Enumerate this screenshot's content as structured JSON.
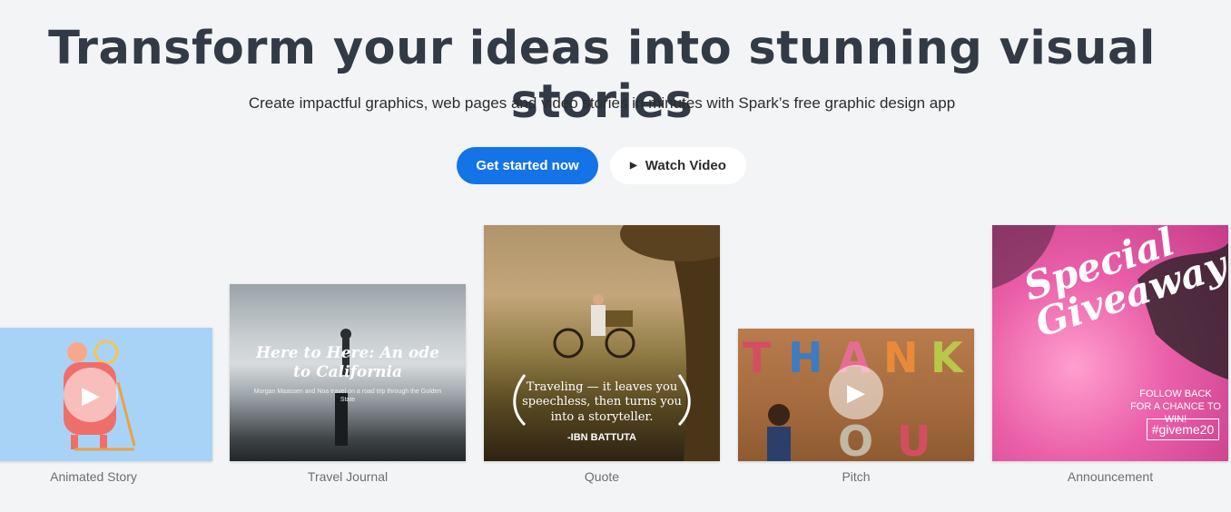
{
  "hero": {
    "title": "Transform your ideas into stunning visual stories",
    "subtitle": "Create impactful graphics, web pages and video stories in minutes with Spark’s free graphic design app"
  },
  "cta": {
    "primary_label": "Get started now",
    "secondary_label": "Watch Video",
    "secondary_icon": "play-icon"
  },
  "colors": {
    "accent": "#1473e6",
    "background": "#f2f4f6"
  },
  "cards": [
    {
      "label": "Animated Story"
    },
    {
      "label": "Travel Journal",
      "overlay_title": "Here to Here: An ode to California",
      "overlay_subtitle": "Morgan Maassen and Noa travel on a road trip through the Golden State"
    },
    {
      "label": "Quote",
      "quote": "Traveling — it leaves you speechless, then turns you into a storyteller.",
      "author": "-IBN BATTUTA"
    },
    {
      "label": "Pitch",
      "letters": "THANK YOU"
    },
    {
      "label": "Announcement",
      "promo_title": "Special Giveaway",
      "promo_sub": "FOLLOW BACK FOR A CHANCE TO WIN!",
      "promo_tag": "#giveme20"
    }
  ]
}
